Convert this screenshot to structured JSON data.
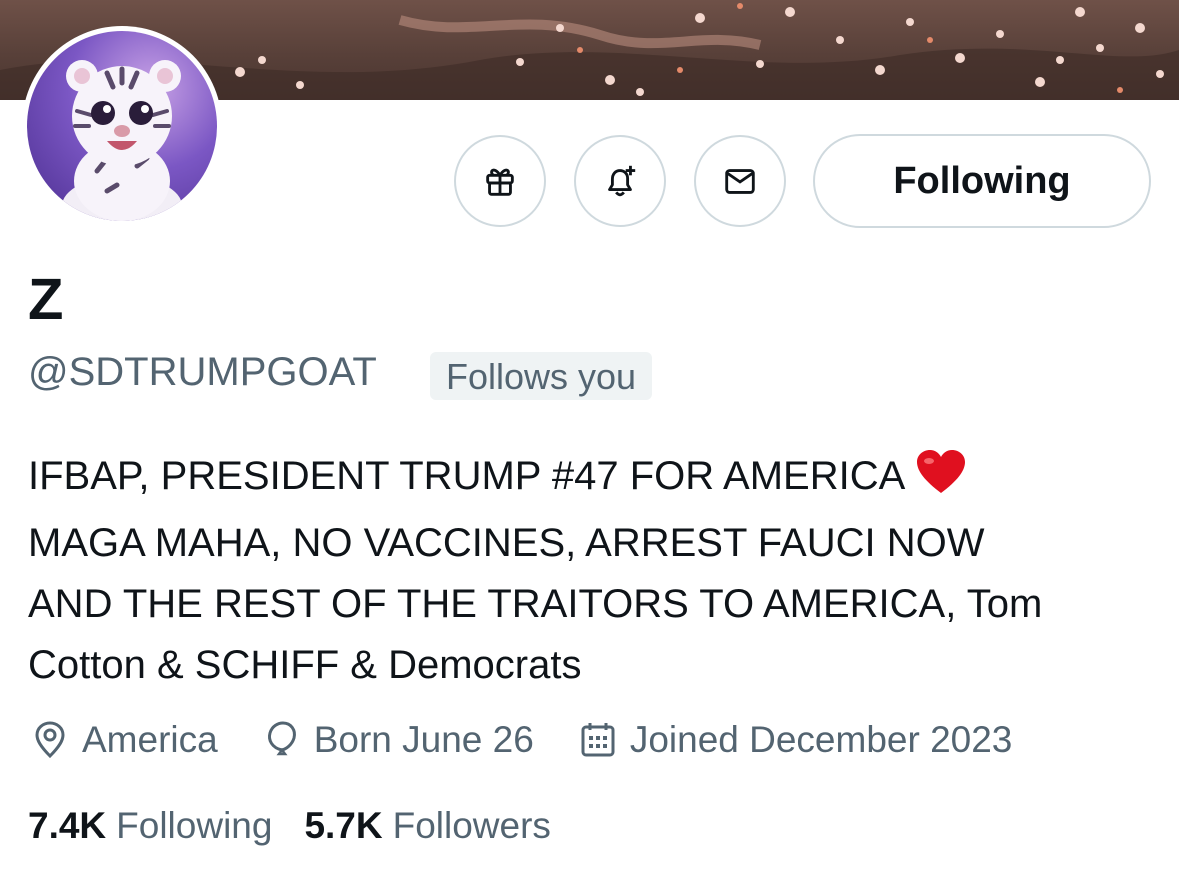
{
  "profile": {
    "display_name": "Z",
    "handle": "@SDTRUMPGOAT",
    "follows_you_label": "Follows you",
    "bio_lines": [
      "IFBAP, PRESIDENT TRUMP #47 FOR AMERICA",
      "MAGA MAHA, NO VACCINES, ARREST FAUCI NOW",
      "AND THE REST OF THE TRAITORS TO AMERICA, Tom",
      "Cotton & SCHIFF & Democrats"
    ],
    "bio_emoji": "heart-emoji",
    "location": "America",
    "birthday": "Born June 26",
    "joined": "Joined December 2023"
  },
  "actions": {
    "gift_icon": "gift-icon",
    "notify_icon": "bell-plus-icon",
    "message_icon": "envelope-icon",
    "follow_label": "Following"
  },
  "stats": {
    "following_count": "7.4K",
    "following_label": "Following",
    "followers_count": "5.7K",
    "followers_label": "Followers"
  },
  "colors": {
    "text_primary": "#0f1419",
    "text_secondary": "#536471",
    "border": "#cfd9de",
    "badge_bg": "#eff3f4",
    "heart": "#e0101f"
  }
}
